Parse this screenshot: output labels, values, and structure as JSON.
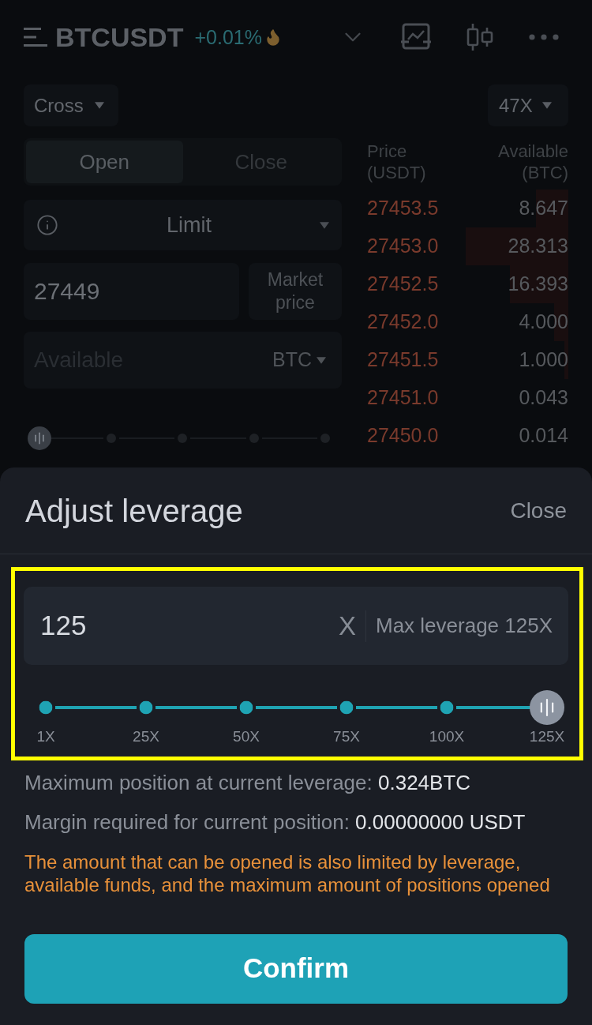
{
  "header": {
    "symbol": "BTCUSDT",
    "change": "+0.01%"
  },
  "margin_mode": {
    "label": "Cross"
  },
  "leverage": {
    "label": "47X"
  },
  "order_form": {
    "tabs": [
      {
        "label": "Open",
        "selected": true
      },
      {
        "label": "Close",
        "selected": false
      }
    ],
    "order_type": "Limit",
    "price": {
      "value": "27449"
    },
    "market_price": "Market price",
    "amount": {
      "placeholder": "Available",
      "unit": "BTC"
    },
    "slider": {
      "level": 0
    }
  },
  "order_book": {
    "columns": [
      {
        "title": "Price",
        "unit": "(USDT)"
      },
      {
        "title": "Available",
        "unit": "(BTC)"
      }
    ],
    "rows": [
      {
        "price": "27453.5",
        "amount": "8.647",
        "level": 0.16
      },
      {
        "price": "27453.0",
        "amount": "28.313",
        "level": 0.51
      },
      {
        "price": "27452.5",
        "amount": "16.393",
        "level": 0.29
      },
      {
        "price": "27452.0",
        "amount": "4.000",
        "level": 0.07
      },
      {
        "price": "27451.5",
        "amount": "1.000",
        "level": 0.02
      },
      {
        "price": "27451.0",
        "amount": "0.043"
      },
      {
        "price": "27450.0",
        "amount": "0.014"
      }
    ]
  },
  "leverage_sheet": {
    "title": "Adjust leverage",
    "close": "Close",
    "highlighted": true,
    "input": {
      "value": "125",
      "unit": "X",
      "limit_note": "Max leverage 125X"
    },
    "slider": {
      "level": 1,
      "ticks": [
        "1X",
        "25X",
        "50X",
        "75X",
        "100X",
        "125X"
      ]
    },
    "details": [
      {
        "label": "Maximum position at current leverage:",
        "value": "0.324BTC"
      },
      {
        "label": "Margin required for current position:",
        "value": "0.00000000 USDT"
      }
    ],
    "warning": "The amount that can be opened is also limited by leverage, available funds, and the maximum amount of positions opened",
    "confirm": "Confirm"
  }
}
